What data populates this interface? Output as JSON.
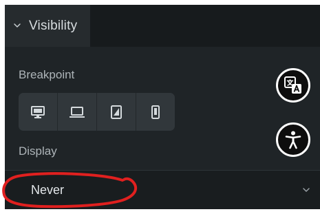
{
  "panel": {
    "tab": {
      "label": "Visibility",
      "chevron_icon": "chevron-down-icon"
    },
    "breakpoint": {
      "label": "Breakpoint",
      "buttons": [
        {
          "name": "desktop",
          "icon": "desktop-icon"
        },
        {
          "name": "laptop",
          "icon": "laptop-icon"
        },
        {
          "name": "tablet",
          "icon": "tablet-icon"
        },
        {
          "name": "mobile",
          "icon": "mobile-icon"
        }
      ]
    },
    "display": {
      "label": "Display",
      "value": "Never",
      "chevron_icon": "chevron-down-icon"
    }
  },
  "floating_buttons": [
    {
      "name": "translate",
      "icon": "translate-icon"
    },
    {
      "name": "accessibility",
      "icon": "accessibility-icon"
    }
  ],
  "annotation": {
    "type": "freehand-circle",
    "color": "#e0201f",
    "target": "display-select"
  },
  "colors": {
    "panel_bg": "#1f2427",
    "tab_bg": "#262b2e",
    "button_group_bg": "#31373b",
    "select_bg": "#191d1f",
    "text_primary": "#e3e7ea",
    "text_secondary": "#aeb5b9"
  }
}
